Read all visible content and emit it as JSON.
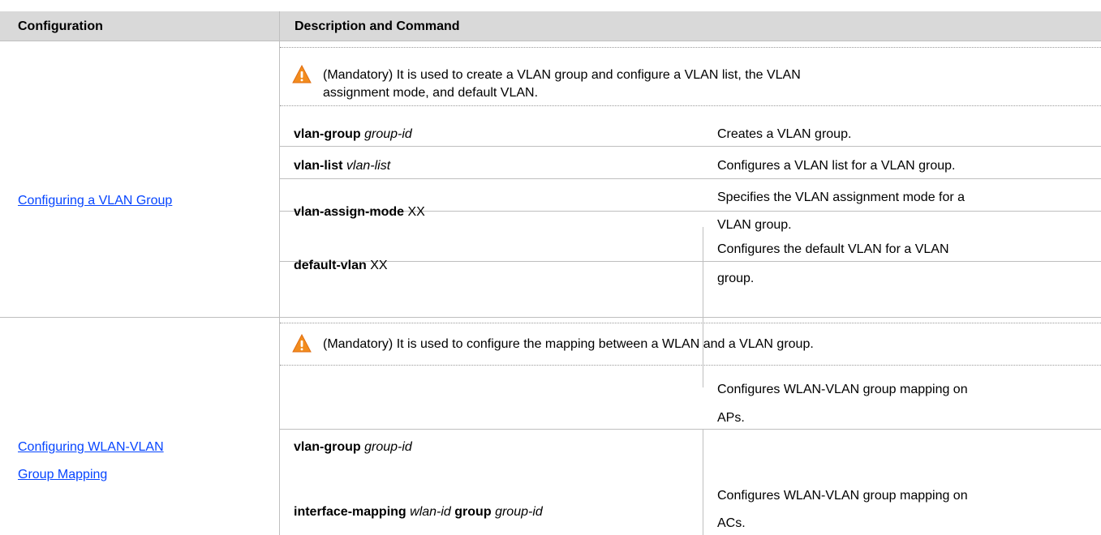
{
  "header": {
    "col_configuration": "Configuration",
    "col_description": "Description and Command"
  },
  "colors": {
    "header_bg": "#d9d9d9",
    "link": "#0645ff",
    "warning_fill": "#f28c1e",
    "grid": "#bfbfbf"
  },
  "section1": {
    "link_label": "Configuring a VLAN Group",
    "note_icon": "warning-triangle-icon",
    "note_line1": "(Mandatory) It is used to create a VLAN group and configure a VLAN list, the VLAN",
    "note_line2": "assignment mode, and default VLAN.",
    "rows": [
      {
        "cmd_bold": "vlan-group",
        "cmd_arg": "group-id",
        "desc_line1": "Creates a VLAN group.",
        "desc_line2": ""
      },
      {
        "cmd_bold": "vlan-list",
        "cmd_arg": "vlan-list",
        "desc_line1": "Configures a VLAN list for a VLAN group.",
        "desc_line2": ""
      },
      {
        "cmd_bold": "vlan-assign-mode",
        "cmd_arg": "XX",
        "desc_line1": "Specifies the VLAN assignment mode for a",
        "desc_line2": "VLAN group."
      },
      {
        "cmd_bold": "default-vlan",
        "cmd_arg": "XX",
        "desc_line1": "Configures the default VLAN for a VLAN",
        "desc_line2": "group."
      }
    ]
  },
  "section2": {
    "link_line1": "Configuring WLAN-VLAN ",
    "link_line2": "Group Mapping",
    "note_icon": "warning-triangle-icon",
    "note_line1": "(Mandatory) It is used to configure the mapping between a WLAN and a VLAN group.",
    "rows": [
      {
        "cmd_bold": "vlan-group",
        "cmd_arg": "group-id",
        "desc_line1": "Configures WLAN-VLAN group mapping on",
        "desc_line2": "APs."
      },
      {
        "cmd_bold": "interface-mapping",
        "cmd_arg": "wlan-id",
        "cmd_bold2": "group",
        "cmd_arg2": "group-id",
        "desc_line1": "Configures WLAN-VLAN group mapping on",
        "desc_line2": "ACs."
      }
    ]
  }
}
